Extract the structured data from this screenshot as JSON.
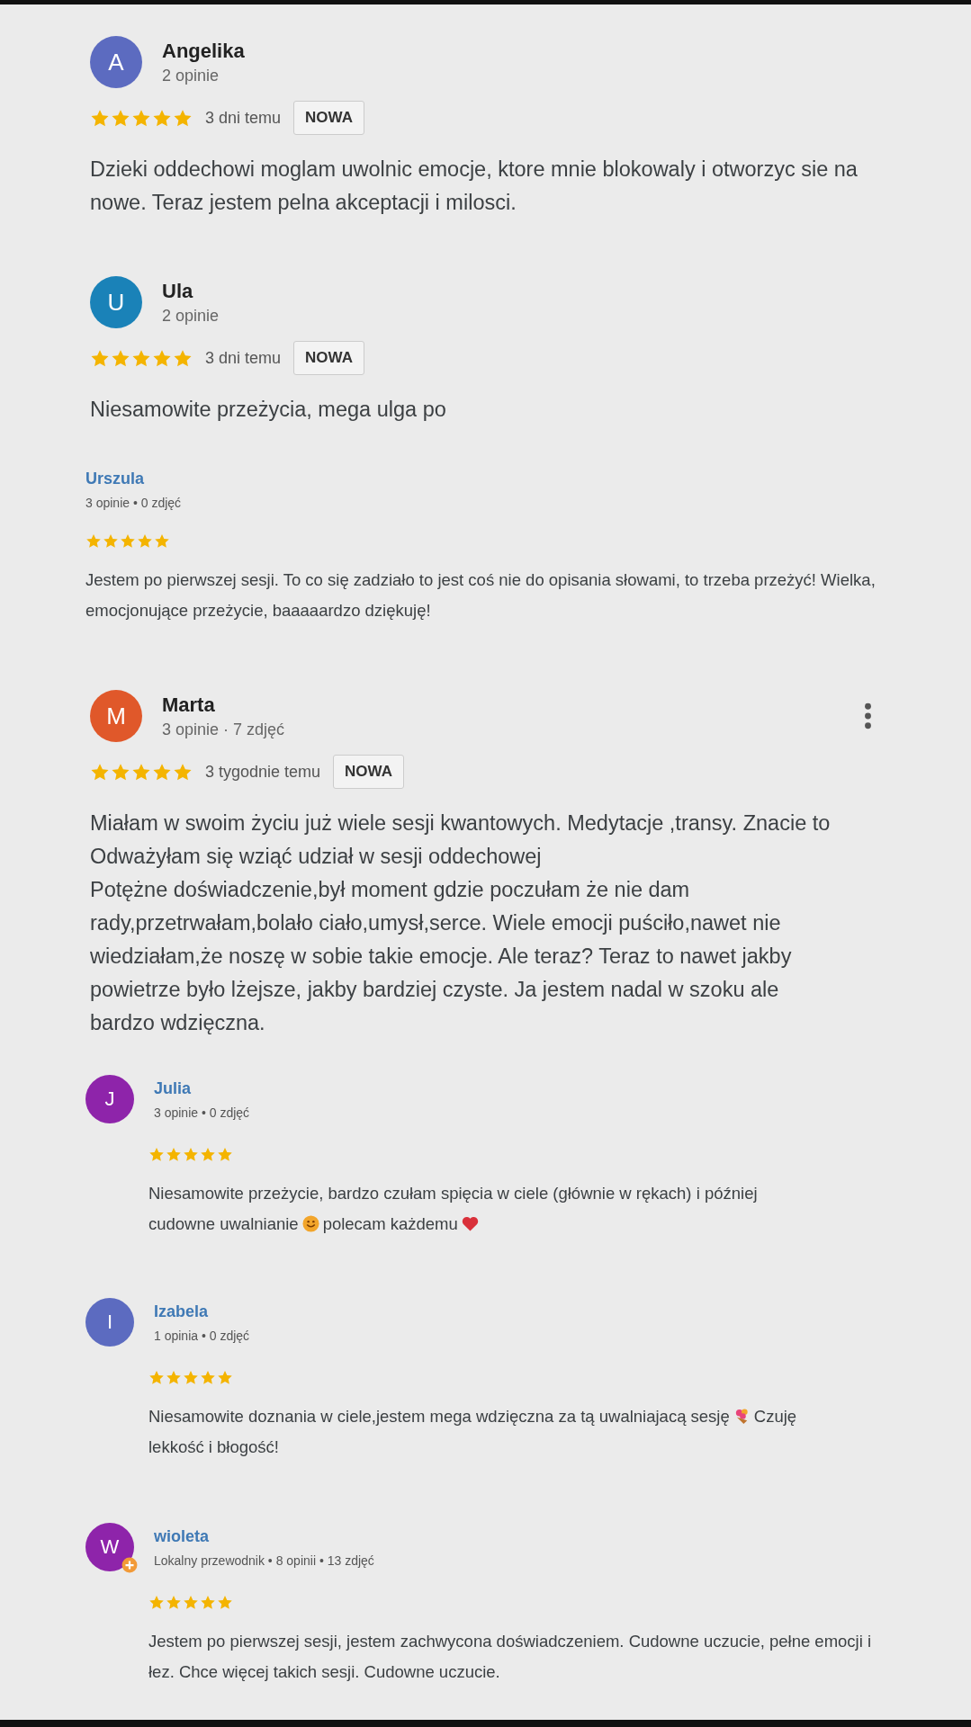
{
  "reviews": [
    {
      "kind": "large",
      "initial": "A",
      "color": "#5c6bc0",
      "name": "Angelika",
      "meta": "2 opinie",
      "stars": 5,
      "time": "3 dni temu",
      "badge": "NOWA",
      "menu": false,
      "parts": [
        {
          "kind": "text",
          "text": "Dzieki oddechowi moglam uwolnic emocje, ktore mnie blokowaly i otworzyc sie na nowe. Teraz jestem pelna akceptacji i milosci."
        }
      ]
    },
    {
      "kind": "large",
      "initial": "U",
      "color": "#1a82b8",
      "name": "Ula",
      "meta": "2 opinie",
      "stars": 5,
      "time": "3 dni temu",
      "badge": "NOWA",
      "menu": false,
      "parts": [
        {
          "kind": "text",
          "text": "Niesamowite przeżycia, mega ulga po"
        }
      ]
    },
    {
      "kind": "compact",
      "name": "Urszula",
      "meta": "3 opinie • 0 zdjęć",
      "stars": 5,
      "parts": [
        {
          "kind": "text",
          "text": "Jestem po pierwszej sesji. To co się zadziało to jest coś nie do opisania słowami, to trzeba przeżyć! Wielka, emocjonujące przeżycie, baaaaardzo dziękuję!"
        }
      ]
    },
    {
      "kind": "large",
      "initial": "M",
      "color": "#e0582a",
      "name": "Marta",
      "meta": "3 opinie · 7 zdjęć",
      "stars": 5,
      "time": "3 tygodnie temu",
      "badge": "NOWA",
      "menu": true,
      "parts": [
        {
          "kind": "text",
          "text": "Miałam w swoim życiu już wiele sesji kwantowych. Medytacje ,transy. Znacie to\nOdważyłam się wziąć udział w sesji oddechowej\nPotężne doświadczenie,był moment gdzie poczułam że nie dam\nrady,przetrwałam,bolało ciało,umysł,serce. Wiele emocji puściło,nawet nie\nwiedziałam,że noszę w sobie takie emocje. Ale teraz? Teraz to nawet jakby\npowietrze było lżejsze, jakby bardziej czyste. Ja jestem nadal w szoku ale\nbardzo wdzięczna."
        }
      ]
    },
    {
      "kind": "compact",
      "initial": "J",
      "color": "#8e24aa",
      "name": "Julia",
      "meta": "3 opinie • 0 zdjęć",
      "stars": 5,
      "parts": [
        {
          "kind": "text",
          "text": "Niesamowite przeżycie, bardzo czułam spięcia w ciele (głównie w rękach) i później"
        },
        {
          "kind": "break"
        },
        {
          "kind": "text",
          "text": "cudowne uwalnianie"
        },
        {
          "kind": "smiley"
        },
        {
          "kind": "text",
          "text": "polecam każdemu"
        },
        {
          "kind": "heart"
        }
      ]
    },
    {
      "kind": "compact",
      "initial": "I",
      "color": "#5c6bc0",
      "name": "Izabela",
      "meta": "1 opinia • 0 zdjęć",
      "stars": 5,
      "parts": [
        {
          "kind": "text",
          "text": "Niesamowite doznania w ciele,jestem mega wdzięczna za tą uwalniajacą sesję"
        },
        {
          "kind": "bouquet"
        },
        {
          "kind": "text",
          "text": "Czuję"
        },
        {
          "kind": "break"
        },
        {
          "kind": "text",
          "text": "lekkość i błogość!"
        }
      ]
    },
    {
      "kind": "compact",
      "initial": "W",
      "color": "#8e24aa",
      "guide": true,
      "name": "wioleta",
      "meta": "Lokalny przewodnik • 8 opinii • 13 zdjęć",
      "stars": 5,
      "parts": [
        {
          "kind": "text",
          "text": "Jestem po pierwszej sesji, jestem zachwycona doświadczeniem. Cudowne uczucie, pełne emocji i łez. Chce więcej takich sesji. Cudowne uczucie."
        }
      ]
    }
  ]
}
